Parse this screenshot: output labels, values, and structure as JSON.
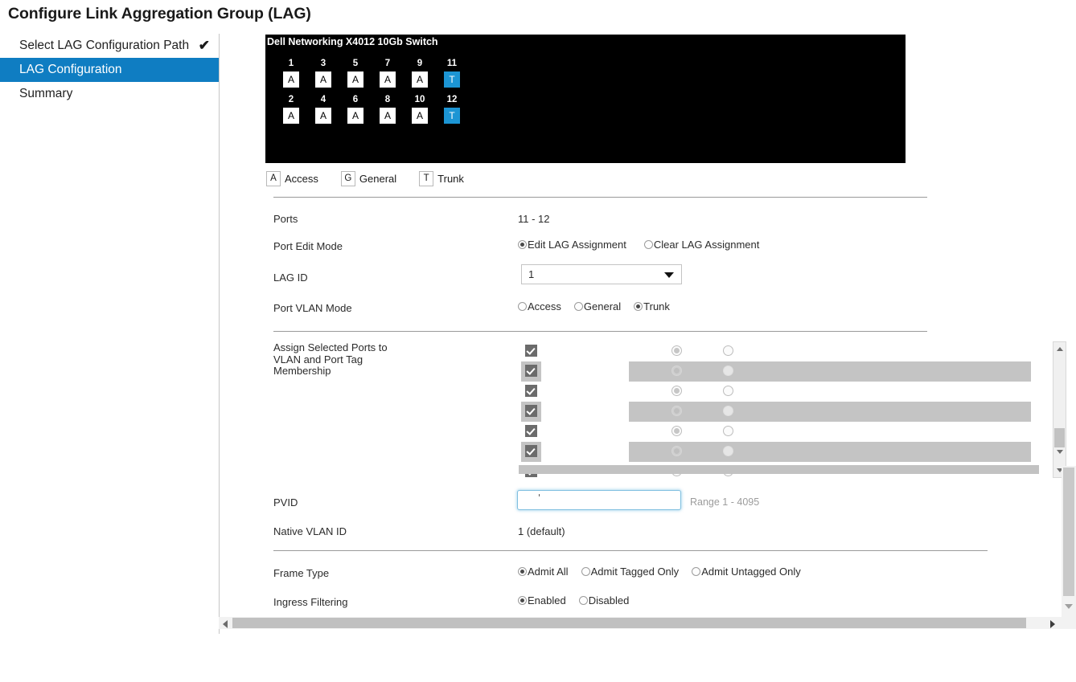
{
  "page_title": "Configure Link Aggregation Group (LAG)",
  "wizard": {
    "items": [
      {
        "label": "Select LAG Configuration Path",
        "completed": true,
        "active": false,
        "check": "✔"
      },
      {
        "label": "LAG Configuration",
        "completed": false,
        "active": true,
        "check": ""
      },
      {
        "label": "Summary",
        "completed": false,
        "active": false,
        "check": ""
      }
    ]
  },
  "switch": {
    "title": "Dell Networking X4012 10Gb Switch",
    "top_row": [
      {
        "number": "1",
        "mode": "A"
      },
      {
        "number": "3",
        "mode": "A"
      },
      {
        "number": "5",
        "mode": "A"
      },
      {
        "number": "7",
        "mode": "A"
      },
      {
        "number": "9",
        "mode": "A"
      },
      {
        "number": "11",
        "mode": "T"
      }
    ],
    "bottom_row": [
      {
        "number": "2",
        "mode": "A"
      },
      {
        "number": "4",
        "mode": "A"
      },
      {
        "number": "6",
        "mode": "A"
      },
      {
        "number": "8",
        "mode": "A"
      },
      {
        "number": "10",
        "mode": "A"
      },
      {
        "number": "12",
        "mode": "T"
      }
    ],
    "trunk_color": "#1c95d4",
    "legend": [
      {
        "key": "A",
        "label": "Access"
      },
      {
        "key": "G",
        "label": "General"
      },
      {
        "key": "T",
        "label": "Trunk"
      }
    ]
  },
  "form": {
    "ports": {
      "label": "Ports",
      "value": "11 - 12"
    },
    "port_edit_mode": {
      "label": "Port Edit Mode",
      "options": [
        {
          "label": "Edit LAG Assignment",
          "selected": true
        },
        {
          "label": "Clear LAG Assignment",
          "selected": false
        }
      ]
    },
    "lag_id": {
      "label": "LAG ID",
      "value": "1"
    },
    "port_vlan_mode": {
      "label": "Port VLAN Mode",
      "options": [
        {
          "label": "Access",
          "selected": false
        },
        {
          "label": "General",
          "selected": false
        },
        {
          "label": "Trunk",
          "selected": true
        }
      ]
    },
    "vlan_membership": {
      "label": "Assign Selected Ports to VLAN and Port Tag Membership",
      "rows": [
        {
          "checked": true,
          "radio1": true,
          "radio2": false,
          "alt": false
        },
        {
          "checked": true,
          "radio1": true,
          "radio2": false,
          "alt": true
        },
        {
          "checked": true,
          "radio1": true,
          "radio2": false,
          "alt": false
        },
        {
          "checked": true,
          "radio1": true,
          "radio2": false,
          "alt": true
        },
        {
          "checked": true,
          "radio1": true,
          "radio2": false,
          "alt": false
        },
        {
          "checked": true,
          "radio1": true,
          "radio2": false,
          "alt": true
        },
        {
          "checked": true,
          "radio1": true,
          "radio2": false,
          "alt": false
        }
      ]
    },
    "pvid": {
      "label": "PVID",
      "value": "",
      "hint": "Range 1 - 4095"
    },
    "native_vlan_id": {
      "label": "Native VLAN ID",
      "value": "1 (default)"
    },
    "frame_type": {
      "label": "Frame Type",
      "options": [
        {
          "label": "Admit All",
          "selected": true
        },
        {
          "label": "Admit Tagged Only",
          "selected": false
        },
        {
          "label": "Admit Untagged Only",
          "selected": false
        }
      ]
    },
    "ingress_filtering": {
      "label": "Ingress Filtering",
      "options": [
        {
          "label": "Enabled",
          "selected": true
        },
        {
          "label": "Disabled",
          "selected": false
        }
      ]
    }
  },
  "theme": {
    "accent": "#0f7dc2",
    "panel_bg": "#000000",
    "row_alt": "#c4c4c4"
  }
}
